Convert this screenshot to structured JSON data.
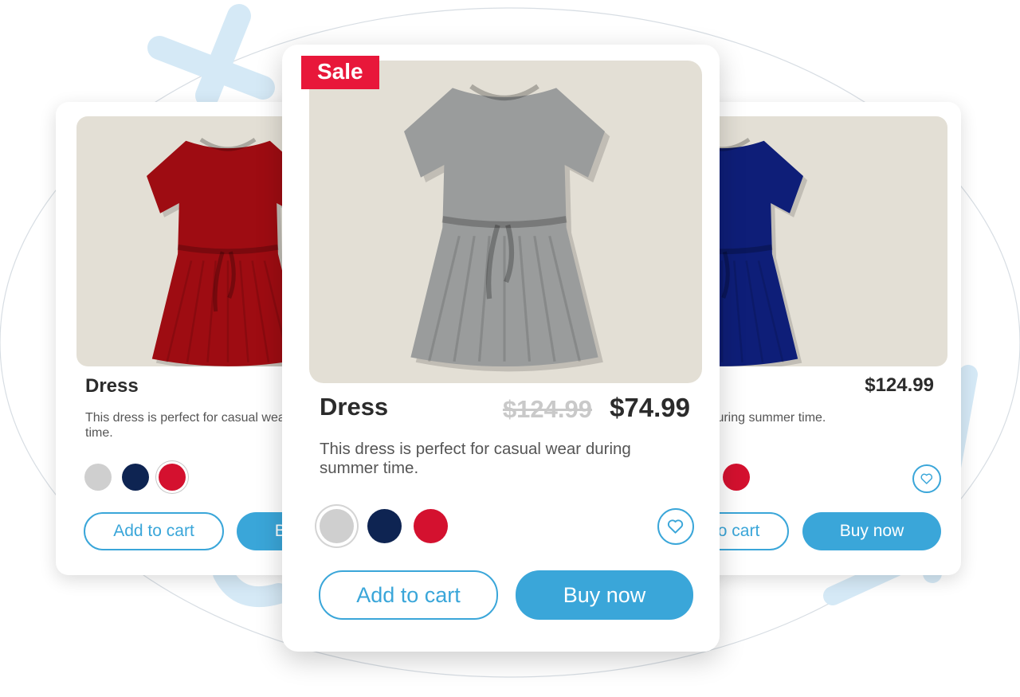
{
  "cards": {
    "left": {
      "title": "Dress",
      "description": "This dress is perfect for casual wear during summer time.",
      "add_to_cart": "Add to cart",
      "buy_now": "Buy now",
      "dress_color": "#9e0c12",
      "selected_color": "red"
    },
    "center": {
      "badge": "Sale",
      "title": "Dress",
      "old_price": "$124.99",
      "price": "$74.99",
      "description": "This dress is perfect for casual wear during summer time.",
      "add_to_cart": "Add to cart",
      "buy_now": "Buy now",
      "dress_color": "#9a9c9c",
      "selected_color": "gray"
    },
    "right": {
      "price": "$124.99",
      "description": "This dress is perfect for casual wear during summer time.",
      "add_to_cart": "Add to cart",
      "buy_now": "Buy now",
      "dress_color": "#0e1e78"
    }
  },
  "colors": {
    "accent": "#3aa6d9",
    "sale": "#e8173a",
    "swatch_gray": "#cfcfcf",
    "swatch_navy": "#0e2452",
    "swatch_red": "#d4112f"
  },
  "icons": [
    "heart-icon"
  ]
}
